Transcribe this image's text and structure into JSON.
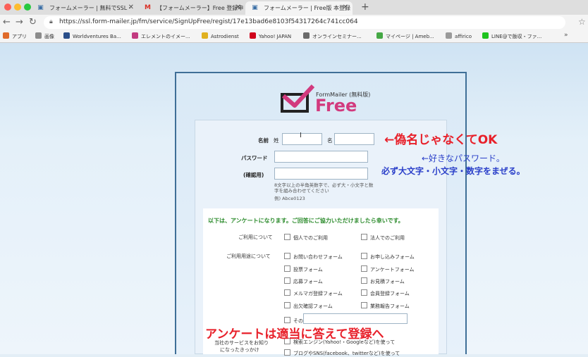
{
  "tabs": [
    {
      "label": "フォームメーラー | 無料でSSL・",
      "icon": "form-icon"
    },
    {
      "label": "【フォームメーラー】Free 登録申",
      "icon": "gmail-icon"
    },
    {
      "label": "フォームメーラー | Free版 本登録",
      "icon": "form-icon",
      "active": true
    }
  ],
  "toolbar": {
    "url": "https://ssl.form-mailer.jp/fm/service/SignUpFree/regist/17e13bad6e8103f54317264c741cc064"
  },
  "bookmarks": [
    {
      "label": "アプリ",
      "color": "#e06a2a"
    },
    {
      "label": "画像",
      "color": "#8c8c8c"
    },
    {
      "label": "Worldventures Ba...",
      "color": "#2a4f8a"
    },
    {
      "label": "エレメントのイメー...",
      "color": "#c23b80"
    },
    {
      "label": "Astrodienst",
      "color": "#e0b020"
    },
    {
      "label": "Yahoo! JAPAN",
      "color": "#d0021b"
    },
    {
      "label": "オンラインセミナー...",
      "color": "#6a6a6a"
    },
    {
      "label": "マイページ | Ameb...",
      "color": "#45a845"
    },
    {
      "label": "affirico",
      "color": "#9a9a9a"
    },
    {
      "label": "LINE@で飯収・ファ...",
      "color": "#1ec31e"
    }
  ],
  "logo": {
    "brand": "FormMailer (無料版)",
    "name": "Free"
  },
  "form": {
    "name_label": "名前",
    "sei_label": "姓",
    "mei_label": "名",
    "password_label": "パスワード",
    "confirm_label": "(確認用)",
    "password_note": "8文字以上の半角英数字で、必ず大・小文字と数字を組み合わせてください",
    "password_example": "例) Abce0123"
  },
  "survey": {
    "heading": "以下は、アンケートになります。ご回答にご協力いただけましたら幸いです。",
    "usage_label": "ご利用について",
    "usage_options": [
      "個人でのご利用",
      "法人でのご利用"
    ],
    "purpose_label": "ご利用用途について",
    "purpose_options": [
      "お問い合わせフォーム",
      "お申し込みフォーム",
      "投票フォーム",
      "アンケートフォーム",
      "応募フォーム",
      "お見積フォーム",
      "メルマガ登録フォーム",
      "会員登録フォーム",
      "出欠確認フォーム",
      "業務報告フォーム",
      "その他"
    ],
    "source_label_1": "当社のサービスをお知り",
    "source_label_2": "になったきっかけ",
    "source_options": [
      "検索エンジン(Yahoo!・Googleなど)を使って",
      "ブログやSNS(facebook、twitterなど)を使って"
    ]
  },
  "annotations": {
    "name": "←偽名じゃなくてOK",
    "password_1": "←好きなパスワード。",
    "password_2": "必ず大文字・小文字・数字をまぜる。",
    "survey": "アンケートは適当に答えて登録へ",
    "red": "#e8202a",
    "blue": "#2a3fc9"
  }
}
